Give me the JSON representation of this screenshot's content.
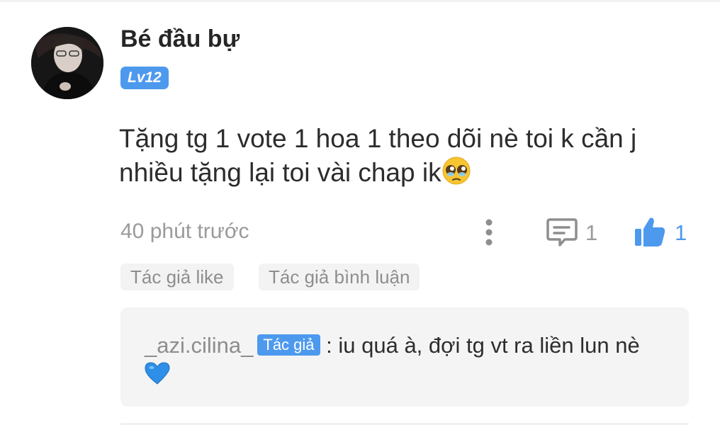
{
  "comment": {
    "username": "Bé đầu bự",
    "level": "Lv12",
    "text": "Tặng tg 1 vote 1 hoa 1 theo dõi nè toi k cần j nhiều tặng lại toi vài chap ik",
    "text_emoji": "pleading-face-emoji",
    "time": "40 phút trước",
    "reply_count": "1",
    "like_count": "1",
    "tags": [
      "Tác giả like",
      "Tác giả bình luận"
    ]
  },
  "reply": {
    "author": "_azi.cilina_",
    "badge": "Tác giả",
    "text": " : iu quá à, đợi tg vt ra liền lun nè ",
    "text_emoji": "blue-heart-emoji"
  },
  "colors": {
    "accent": "#4d99ee",
    "muted": "#9a9a9a",
    "text": "#2c2c2c"
  },
  "icons": [
    "more-vertical-icon",
    "comment-icon",
    "thumbs-up-icon"
  ]
}
